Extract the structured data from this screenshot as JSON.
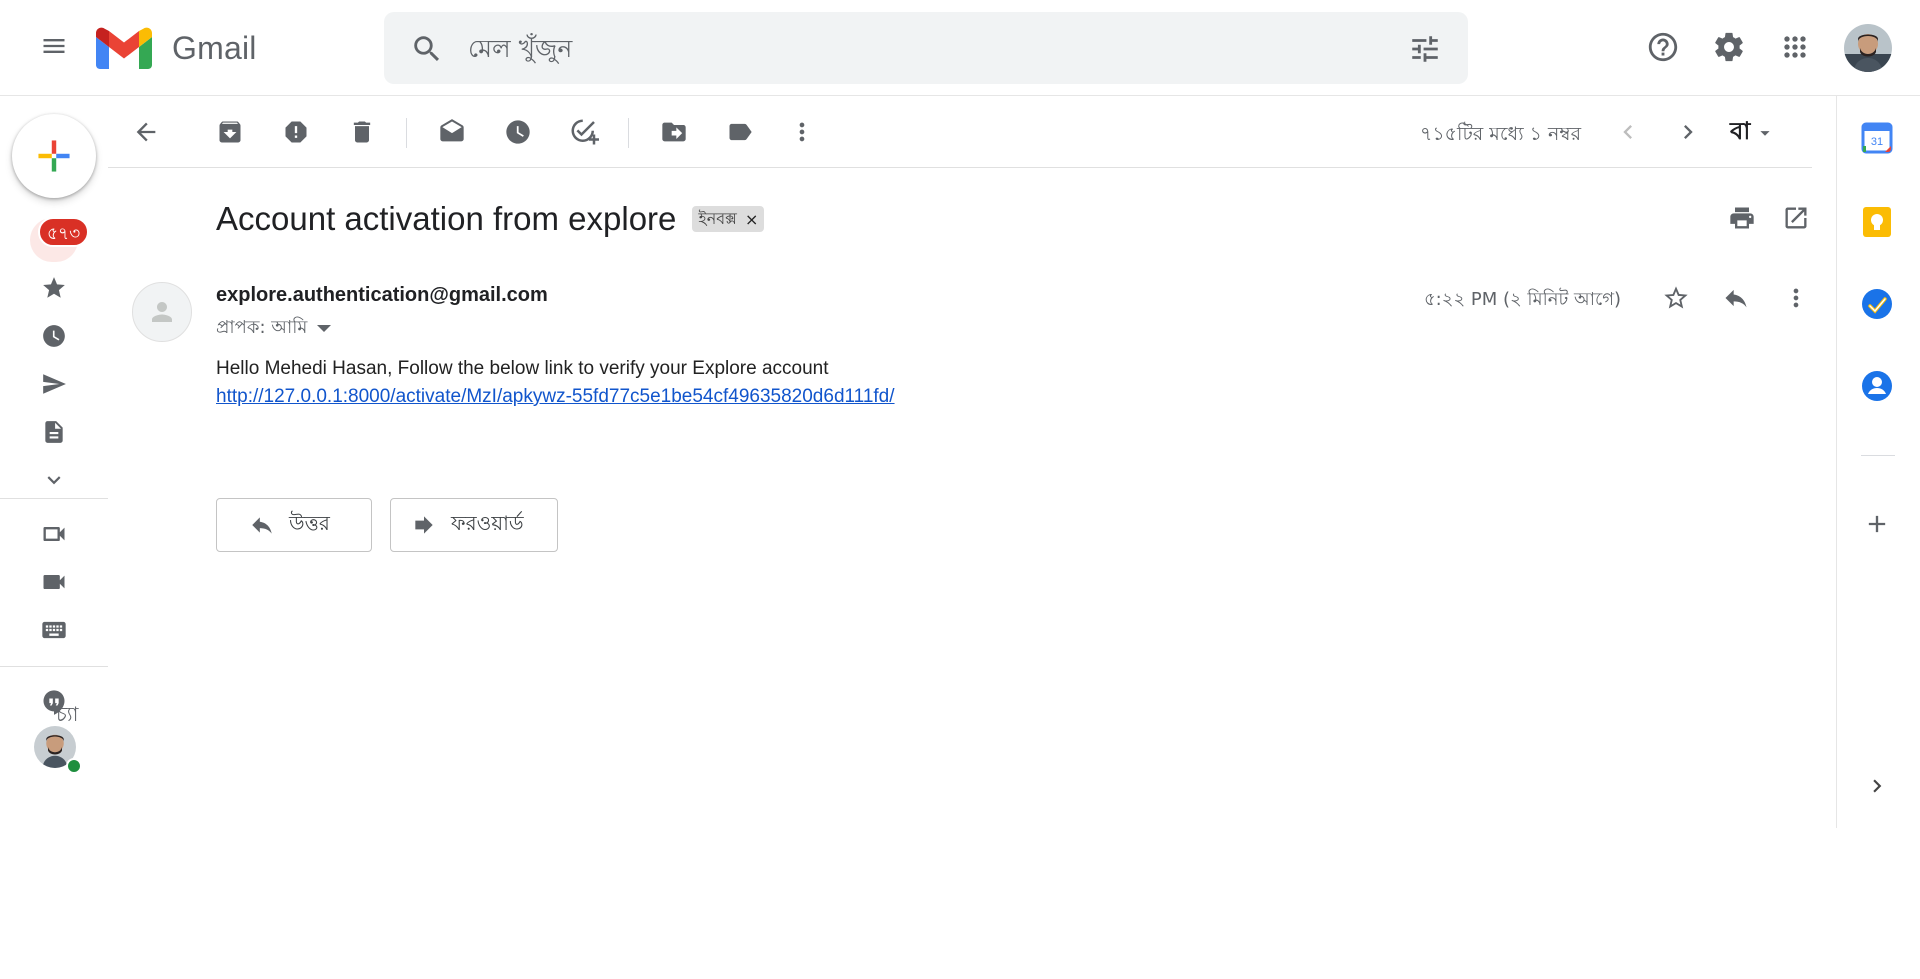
{
  "header": {
    "app_name": "Gmail",
    "search_placeholder": "মেল খুঁজুন"
  },
  "rail": {
    "inbox_badge": "৫৭৩",
    "chat_label": "চ্যা"
  },
  "toolbar": {
    "pager": "৭১৫টির মধ্যে ১ নম্বর",
    "input_language": "বা"
  },
  "email": {
    "subject": "Account activation from explore",
    "label": "ইনবক্স",
    "label_remove": "×",
    "sender": "explore.authentication@gmail.com",
    "recipient": "প্রাপক: আমি",
    "time": "৫:২২ PM (২ মিনিট আগে)",
    "body": "Hello Mehedi Hasan, Follow the below link to verify your Explore account",
    "link": "http://127.0.0.1:8000/activate/MzI/apkywz-55fd77c5e1be54cf49635820d6d111fd/",
    "reply_label": "উত্তর",
    "forward_label": "ফরওয়ার্ড"
  },
  "side_panel": {
    "calendar_day": "31"
  },
  "colors": {
    "link": "#1155cc",
    "badge": "#d93025",
    "online": "#1e8e3e",
    "icon": "#5f6368"
  }
}
